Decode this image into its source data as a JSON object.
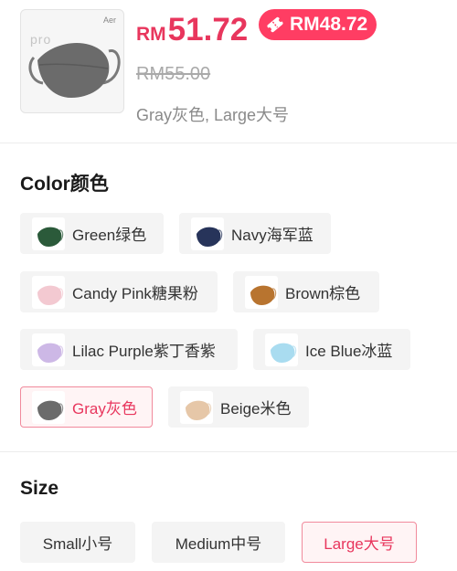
{
  "product": {
    "thumbnail": {
      "brand": "Aer",
      "series": "pro",
      "mask_color": "#6b6b6b"
    },
    "price_currency": "RM",
    "price_value": "51.72",
    "coupon_price": "RM48.72",
    "original_price": "RM55.00",
    "selected_variant": "Gray灰色, Large大号"
  },
  "color_section": {
    "title": "Color颜色",
    "options": [
      {
        "label": "Green绿色",
        "swatch": "#2b5a3a",
        "selected": false
      },
      {
        "label": "Navy海军蓝",
        "swatch": "#27345a",
        "selected": false
      },
      {
        "label": "Candy Pink糖果粉",
        "swatch": "#f3c9d1",
        "selected": false
      },
      {
        "label": "Brown棕色",
        "swatch": "#b8742f",
        "selected": false
      },
      {
        "label": "Lilac Purple紫丁香紫",
        "swatch": "#cdb8e6",
        "selected": false
      },
      {
        "label": "Ice Blue冰蓝",
        "swatch": "#a9dcf0",
        "selected": false
      },
      {
        "label": "Gray灰色",
        "swatch": "#6b6b6b",
        "selected": true
      },
      {
        "label": "Beige米色",
        "swatch": "#e6c7a8",
        "selected": false
      }
    ]
  },
  "size_section": {
    "title": "Size",
    "options": [
      {
        "label": "Small小号",
        "selected": false
      },
      {
        "label": "Medium中号",
        "selected": false
      },
      {
        "label": "Large大号",
        "selected": true
      }
    ]
  },
  "colors": {
    "accent": "#e8365d",
    "coupon_bg": "#ff3d63",
    "chip_bg": "#f4f4f4"
  }
}
